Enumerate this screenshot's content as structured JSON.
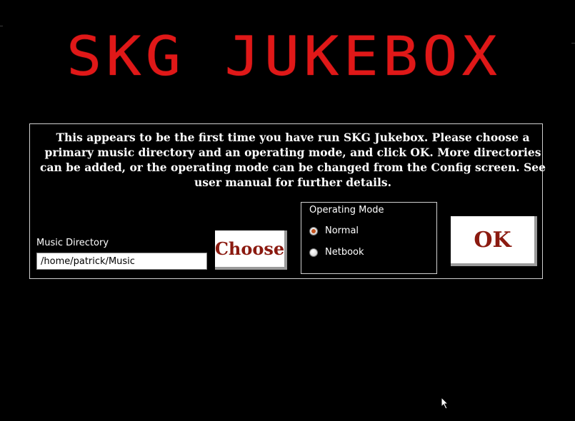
{
  "app": {
    "title": "SKG JUKEBOX"
  },
  "dialog": {
    "message": "This appears to be the first time you have run SKG Jukebox. Please choose a primary music directory and an operating mode, and click OK. More directories can be added, or the operating mode can be changed from the Config screen. See user manual for further details.",
    "music_directory_label": "Music Directory",
    "music_directory_value": "/home/patrick/Music",
    "choose_label": "Choose",
    "operating_mode_label": "Operating Mode",
    "modes": [
      {
        "label": "Normal",
        "selected": true
      },
      {
        "label": "Netbook",
        "selected": false
      }
    ],
    "ok_label": "OK"
  },
  "colors": {
    "background": "#000000",
    "title": "#e01818",
    "button_text": "#8b1a10"
  }
}
